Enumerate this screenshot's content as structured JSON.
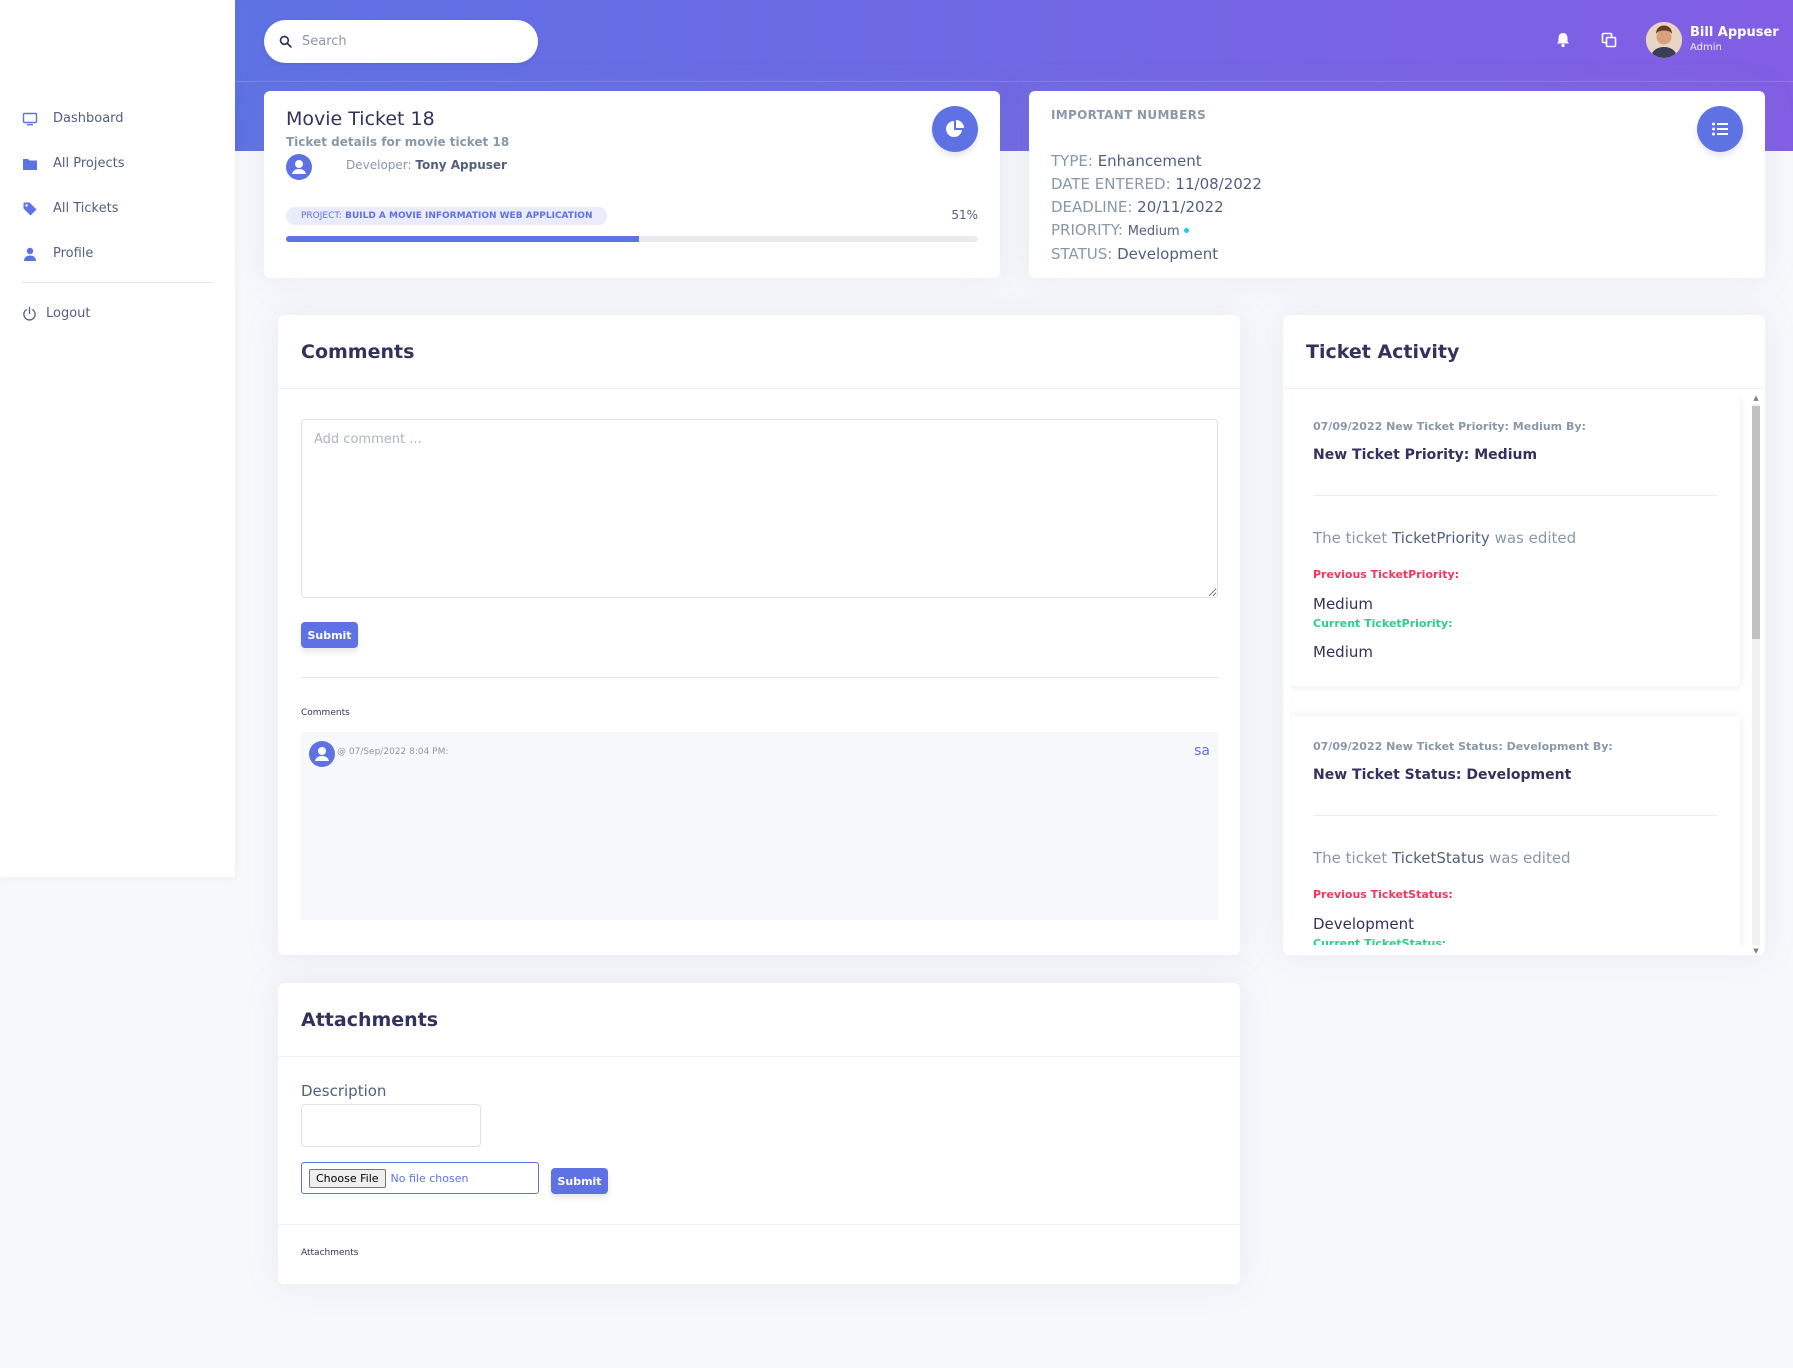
{
  "sidebar": {
    "items": [
      {
        "label": "Dashboard"
      },
      {
        "label": "All Projects"
      },
      {
        "label": "All Tickets"
      },
      {
        "label": "Profile"
      }
    ],
    "logout_label": "Logout"
  },
  "header": {
    "search_placeholder": "Search",
    "user_name": "Bill Appuser",
    "user_role": "Admin"
  },
  "ticket": {
    "title": "Movie Ticket 18",
    "subtitle": "Ticket details for movie ticket 18",
    "developer_label": "Developer:",
    "developer_name": "Tony Appuser",
    "project_prefix": "PROJECT:",
    "project_name": "BUILD A MOVIE INFORMATION WEB APPLICATION",
    "progress_text": "51%",
    "progress_value": 51
  },
  "numbers": {
    "heading": "IMPORTANT NUMBERS",
    "type_label": "TYPE:",
    "type_value": "Enhancement",
    "date_label": "DATE ENTERED:",
    "date_value": "11/08/2022",
    "deadline_label": "DEADLINE:",
    "deadline_value": "20/11/2022",
    "priority_label": "PRIORITY:",
    "priority_value": "Medium",
    "status_label": "STATUS:",
    "status_value": "Development"
  },
  "comments": {
    "title": "Comments",
    "placeholder": "Add comment ...",
    "submit_label": "Submit",
    "list_label": "Comments",
    "items": [
      {
        "meta": "@ 07/Sep/2022 8:04 PM:",
        "text": "sa"
      }
    ]
  },
  "activity": {
    "title": "Ticket Activity",
    "items": [
      {
        "date": "07/09/2022 New Ticket Priority: Medium By:",
        "title": "New Ticket Priority: Medium",
        "edited_prefix": "The ticket",
        "edited_field": "TicketPriority",
        "edited_suffix": "was edited",
        "prev_label": "Previous TicketPriority:",
        "prev_value": "Medium",
        "cur_label": "Current TicketPriority:",
        "cur_value": "Medium"
      },
      {
        "date": "07/09/2022 New Ticket Status: Development By:",
        "title": "New Ticket Status: Development",
        "edited_prefix": "The ticket",
        "edited_field": "TicketStatus",
        "edited_suffix": "was edited",
        "prev_label": "Previous TicketStatus:",
        "prev_value": "Development",
        "cur_label": "Current TicketStatus:",
        "cur_value": ""
      }
    ]
  },
  "attachments": {
    "title": "Attachments",
    "description_label": "Description",
    "choose_file_label": "Choose File",
    "no_file_text": "No file chosen",
    "submit_label": "Submit",
    "list_label": "Attachments"
  },
  "colors": {
    "primary": "#5e72e4",
    "header_gradient_end": "#825ee4",
    "danger": "#f5365c",
    "success": "#2dce89",
    "info": "#11cdef"
  }
}
